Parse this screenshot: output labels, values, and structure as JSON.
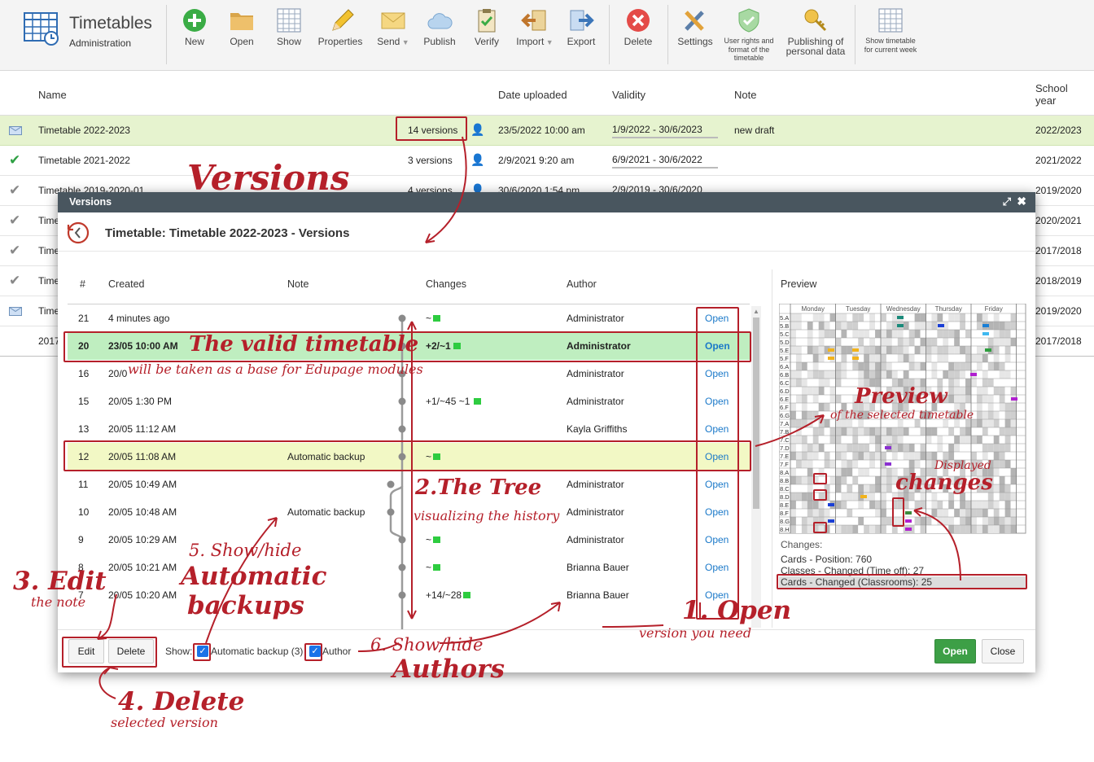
{
  "app": {
    "title": "Timetables",
    "subtitle": "Administration"
  },
  "toolbar": [
    {
      "label": "New",
      "icon": "plus-circle-icon"
    },
    {
      "label": "Open",
      "icon": "folder-icon"
    },
    {
      "label": "Show",
      "icon": "grid-icon"
    },
    {
      "label": "Properties",
      "icon": "pencil-icon"
    },
    {
      "label": "Send",
      "icon": "envelope-icon"
    },
    {
      "label": "Publish",
      "icon": "cloud-icon"
    },
    {
      "label": "Verify",
      "icon": "clipboard-check-icon"
    },
    {
      "label": "Import",
      "icon": "import-icon"
    },
    {
      "label": "Export",
      "icon": "export-icon"
    },
    {
      "label": "Delete",
      "icon": "delete-icon"
    },
    {
      "label": "Settings",
      "icon": "tools-icon"
    },
    {
      "label": "User rights and format of the timetable",
      "icon": "shield-icon"
    },
    {
      "label": "Publishing of personal data",
      "icon": "key-icon"
    },
    {
      "label": "Show timetable for current week",
      "icon": "calendar-grid-icon"
    }
  ],
  "main": {
    "headers": {
      "name": "Name",
      "date": "Date uploaded",
      "validity": "Validity",
      "note": "Note",
      "year": "School year"
    },
    "rows": [
      {
        "name": "Timetable 2022-2023",
        "versions": "14 versions",
        "date": "23/5/2022 10:00 am",
        "validity": "1/9/2022 - 30/6/2023",
        "note": "new draft",
        "year": "2022/2023",
        "status": "envelope-icon"
      },
      {
        "name": "Timetable 2021-2022",
        "versions": "3 versions",
        "date": "2/9/2021 9:20 am",
        "validity": "6/9/2021 - 30/6/2022",
        "note": "",
        "year": "2021/2022",
        "status": "green-check-icon"
      },
      {
        "name": "Timetable 2019-2020-01",
        "versions": "4 versions",
        "date": "30/6/2020 1:54 pm",
        "validity": "2/9/2019 - 30/6/2020",
        "note": "",
        "year": "2019/2020",
        "status": "grey-check-icon"
      },
      {
        "name": "Time",
        "year": "2020/2021",
        "status": "grey-check-icon"
      },
      {
        "name": "Time",
        "year": "2017/2018",
        "status": "grey-check-icon"
      },
      {
        "name": "Time",
        "year": "2018/2019",
        "status": "grey-check-icon"
      },
      {
        "name": "Time",
        "year": "2019/2020",
        "status": "envelope-icon"
      },
      {
        "name": "2017",
        "year": "2017/2018",
        "status": ""
      }
    ]
  },
  "modal": {
    "title": "Versions",
    "heading": "Timetable: Timetable 2022-2023 - Versions",
    "headers": {
      "num": "#",
      "created": "Created",
      "note": "Note",
      "changes": "Changes",
      "author": "Author"
    },
    "open_label": "Open",
    "rows": [
      {
        "num": "21",
        "created": "4 minutes ago",
        "note": "",
        "changes": "~",
        "author": "Administrator"
      },
      {
        "num": "20",
        "created": "23/05 10:00 AM",
        "note": "",
        "changes": "+2/~1",
        "author": "Administrator"
      },
      {
        "num": "16",
        "created": "20/0",
        "note": "",
        "changes": "",
        "author": "Administrator"
      },
      {
        "num": "15",
        "created": "20/05 1:30 PM",
        "note": "",
        "changes": "+1/~45 ~1",
        "author": "Administrator"
      },
      {
        "num": "13",
        "created": "20/05 11:12 AM",
        "note": "",
        "changes": "",
        "author": "Kayla Griffiths"
      },
      {
        "num": "12",
        "created": "20/05 11:08 AM",
        "note": "Automatic backup",
        "changes": "~",
        "author": ""
      },
      {
        "num": "11",
        "created": "20/05 10:49 AM",
        "note": "",
        "changes": "",
        "author": "Administrator"
      },
      {
        "num": "10",
        "created": "20/05 10:48 AM",
        "note": "Automatic backup",
        "changes": "",
        "author": "Administrator"
      },
      {
        "num": "9",
        "created": "20/05 10:29 AM",
        "note": "",
        "changes": "~",
        "author": "Administrator"
      },
      {
        "num": "8",
        "created": "20/05 10:21 AM",
        "note": "",
        "changes": "~",
        "author": "Brianna Bauer"
      },
      {
        "num": "7",
        "created": "20/05 10:20 AM",
        "note": "",
        "changes": "+14/~28",
        "author": "Brianna Bauer"
      }
    ],
    "preview": {
      "label": "Preview",
      "days": [
        "Monday",
        "Tuesday",
        "Wednesday",
        "Thursday",
        "Friday"
      ],
      "classes": [
        "5.A",
        "5.B",
        "5.C",
        "5.D",
        "5.E",
        "5.F",
        "6.A",
        "6.B",
        "6.C",
        "6.D",
        "6.E",
        "6.F",
        "6.G",
        "7.A",
        "7.B",
        "7.C",
        "7.D",
        "7.E",
        "7.F",
        "8.A",
        "8.B",
        "8.C",
        "8.D",
        "8.E",
        "8.F",
        "8.G",
        "8.H"
      ],
      "changes_title": "Changes:",
      "changes": [
        "Cards - Position: 760",
        "Classes - Changed (Time off): 27",
        "Cards - Changed (Classrooms): 25"
      ]
    },
    "footer": {
      "edit": "Edit",
      "delete": "Delete",
      "show": "Show:",
      "auto_backup": "Automatic backup (3)",
      "author": "Author",
      "open": "Open",
      "close": "Close"
    }
  },
  "annotations": {
    "versions": "Versions",
    "valid": "The valid timetable",
    "valid_sub": "will be taken as a base for Edupage modules",
    "preview": "Preview",
    "preview_sub": "of the selected timetable",
    "displayed": "Displayed",
    "changes": "changes",
    "tree": "2.The Tree",
    "tree_sub": "visualizing the history",
    "show_hide5": "5. Show/hide",
    "automatic": "Automatic",
    "backups": "backups",
    "edit": "3. Edit",
    "edit_sub": "the note",
    "open1": "1. Open",
    "open1_sub": "version you need",
    "show_hide6": "6. Show/hide",
    "authors": "Authors",
    "delete4": "4. Delete",
    "delete4_sub": "selected version"
  }
}
